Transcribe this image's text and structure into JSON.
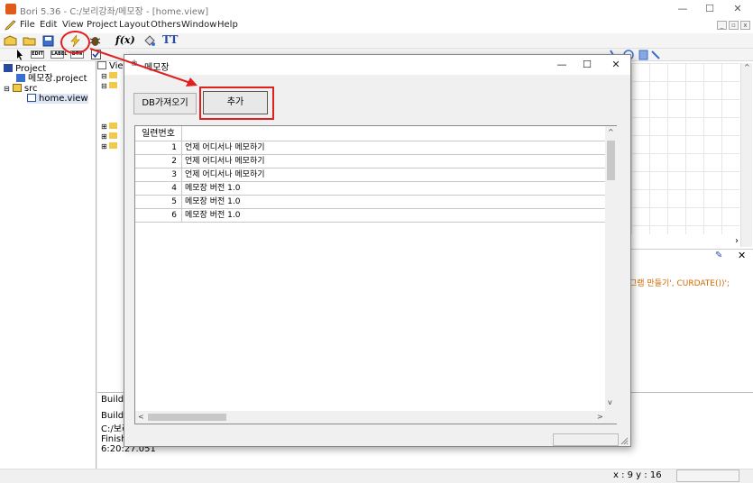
{
  "app": {
    "title": "Bori 5.36 - C:/보리강좌/메모장 - [home.view]",
    "window_controls": [
      "—",
      "☐",
      "✕"
    ]
  },
  "menu": {
    "items": [
      "File",
      "Edit",
      "View",
      "Project",
      "Layout",
      "Others",
      "Window",
      "Help"
    ],
    "mdi_controls": [
      "_",
      "▫",
      "x"
    ]
  },
  "toolbar2": {
    "edit_label": "EDIT",
    "label_label": "LABEL",
    "btn_label": "BTN"
  },
  "project_tree": {
    "items": [
      {
        "label": "Project"
      },
      {
        "label": "메모장.project"
      },
      {
        "label": "src"
      },
      {
        "label": "home.view"
      }
    ]
  },
  "editor": {
    "tab_label": "View",
    "code_fragment": "그램 만들기', CURDATE())';"
  },
  "build": {
    "tab_label": "Build",
    "lines": [
      "Buildin",
      "C:/보리",
      "Finish",
      "6:20:27.051"
    ]
  },
  "status": {
    "coords": "x : 9  y : 16"
  },
  "dialog": {
    "title": "메모장",
    "icon": "bori-icon",
    "controls": [
      "—",
      "☐",
      "✕"
    ],
    "db_button": "DB가져오기",
    "add_button": "추가",
    "table": {
      "header": "일련번호",
      "rows": [
        {
          "no": "1",
          "text": "언제 어디서나 메모하기"
        },
        {
          "no": "2",
          "text": "언제 어디서나 메모하기"
        },
        {
          "no": "3",
          "text": "언제 어디서나 메모하기"
        },
        {
          "no": "4",
          "text": "메모장 버전 1.0"
        },
        {
          "no": "5",
          "text": "메모장 버전 1.0"
        },
        {
          "no": "6",
          "text": "메모장 버전 1.0"
        }
      ]
    }
  },
  "colors": {
    "annotation_red": "#e02020",
    "code_orange": "#d06a00"
  }
}
